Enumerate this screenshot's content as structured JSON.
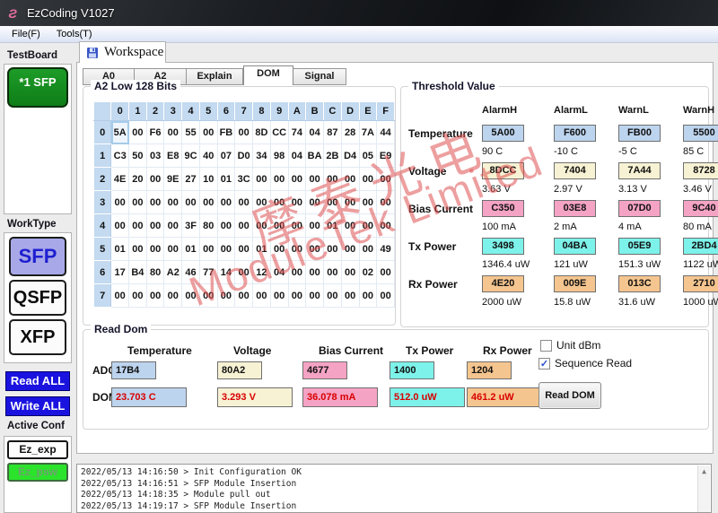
{
  "window": {
    "title": "EzCoding V1027",
    "menu": {
      "file": "File(F)",
      "tools": "Tools(T)"
    }
  },
  "sidebar": {
    "testboard_label": "TestBoard",
    "testboard_item": "*1 SFP",
    "worktype_label": "WorkType",
    "worktype": {
      "sfp": "SFP",
      "qsfp": "QSFP",
      "xfp": "XFP",
      "selected": "SFP"
    },
    "read_all": "Read ALL",
    "write_all": "Write ALL",
    "active_conf_label": "Active Conf",
    "conf": {
      "exp": "Ez_exp",
      "psw": "Ez_psw"
    }
  },
  "workspace": {
    "outer_tab": "Workspace",
    "tabs": [
      "A0",
      "A2",
      "Explain",
      "DOM",
      "Signal"
    ],
    "active_tab": "DOM"
  },
  "hex_grid": {
    "title": "A2 Low 128 Bits",
    "col_headers": [
      "0",
      "1",
      "2",
      "3",
      "4",
      "5",
      "6",
      "7",
      "8",
      "9",
      "A",
      "B",
      "C",
      "D",
      "E",
      "F"
    ],
    "row_headers": [
      "0",
      "1",
      "2",
      "3",
      "4",
      "5",
      "6",
      "7"
    ],
    "rows": [
      [
        "5A",
        "00",
        "F6",
        "00",
        "55",
        "00",
        "FB",
        "00",
        "8D",
        "CC",
        "74",
        "04",
        "87",
        "28",
        "7A",
        "44"
      ],
      [
        "C3",
        "50",
        "03",
        "E8",
        "9C",
        "40",
        "07",
        "D0",
        "34",
        "98",
        "04",
        "BA",
        "2B",
        "D4",
        "05",
        "E9"
      ],
      [
        "4E",
        "20",
        "00",
        "9E",
        "27",
        "10",
        "01",
        "3C",
        "00",
        "00",
        "00",
        "00",
        "00",
        "00",
        "00",
        "00"
      ],
      [
        "00",
        "00",
        "00",
        "00",
        "00",
        "00",
        "00",
        "00",
        "00",
        "00",
        "00",
        "00",
        "00",
        "00",
        "00",
        "00"
      ],
      [
        "00",
        "00",
        "00",
        "00",
        "3F",
        "80",
        "00",
        "00",
        "00",
        "00",
        "00",
        "00",
        "01",
        "00",
        "00",
        "00"
      ],
      [
        "01",
        "00",
        "00",
        "00",
        "01",
        "00",
        "00",
        "00",
        "01",
        "00",
        "00",
        "00",
        "00",
        "00",
        "00",
        "49"
      ],
      [
        "17",
        "B4",
        "80",
        "A2",
        "46",
        "77",
        "14",
        "00",
        "12",
        "04",
        "00",
        "00",
        "00",
        "00",
        "02",
        "00"
      ],
      [
        "00",
        "00",
        "00",
        "00",
        "00",
        "00",
        "00",
        "00",
        "00",
        "00",
        "00",
        "00",
        "00",
        "00",
        "00",
        "00"
      ]
    ],
    "selected_cell": {
      "row": 0,
      "col": 0
    }
  },
  "threshold": {
    "title": "Threshold Value",
    "col_headers": [
      "AlarmH",
      "AlarmL",
      "WarnL",
      "WarnH"
    ],
    "rows": [
      {
        "label": "Temperature",
        "hex": [
          "5A00",
          "F600",
          "FB00",
          "5500"
        ],
        "conv": [
          "90 C",
          "-10 C",
          "-5 C",
          "85 C"
        ],
        "color": "#BDD4EE"
      },
      {
        "label": "Voltage",
        "hex": [
          "8DCC",
          "7404",
          "7A44",
          "8728"
        ],
        "conv": [
          "3.63 V",
          "2.97 V",
          "3.13 V",
          "3.46 V"
        ],
        "color": "#F7F2D3"
      },
      {
        "label": "Bias Current",
        "hex": [
          "C350",
          "03E8",
          "07D0",
          "9C40"
        ],
        "conv": [
          "100 mA",
          "2 mA",
          "4 mA",
          "80 mA"
        ],
        "color": "#F5A3C4"
      },
      {
        "label": "Tx Power",
        "hex": [
          "3498",
          "04BA",
          "05E9",
          "2BD4"
        ],
        "conv": [
          "1346.4 uW",
          "121 uW",
          "151.3 uW",
          "1122 uW"
        ],
        "color": "#7DF2EA"
      },
      {
        "label": "Rx Power",
        "hex": [
          "4E20",
          "009E",
          "013C",
          "2710"
        ],
        "conv": [
          "2000 uW",
          "15.8 uW",
          "31.6 uW",
          "1000 uW"
        ],
        "color": "#F5C58F"
      }
    ]
  },
  "read_dom": {
    "title": "Read Dom",
    "row_labels": {
      "adc": "ADC",
      "dom": "DOM"
    },
    "columns": [
      {
        "header": "Temperature",
        "adc": "17B4",
        "dom": "23.703 C",
        "color": "#BDD4EE"
      },
      {
        "header": "Voltage",
        "adc": "80A2",
        "dom": "3.293 V",
        "color": "#F7F2D3"
      },
      {
        "header": "Bias Current",
        "adc": "4677",
        "dom": "36.078 mA",
        "color": "#F5A3C4"
      },
      {
        "header": "Tx Power",
        "adc": "1400",
        "dom": "512.0 uW",
        "color": "#7DF2EA"
      },
      {
        "header": "Rx Power",
        "adc": "1204",
        "dom": "461.2 uW",
        "color": "#F5C58F"
      }
    ],
    "unit_dbm_label": "Unit dBm",
    "unit_dbm_checked": false,
    "sequence_read_label": "Sequence Read",
    "sequence_read_checked": true,
    "read_dom_button": "Read DOM"
  },
  "log": {
    "lines": [
      "2022/05/13 14:16:50 > Init Configuration OK",
      "2022/05/13 14:16:51 > SFP Module Insertion",
      "2022/05/13 14:18:35 > Module pull out",
      "2022/05/13 14:19:17 > SFP Module Insertion"
    ]
  },
  "watermark": {
    "line1": "摩泰光电",
    "line2": "ModuleTek Limited",
    "color": "#DE5050"
  }
}
